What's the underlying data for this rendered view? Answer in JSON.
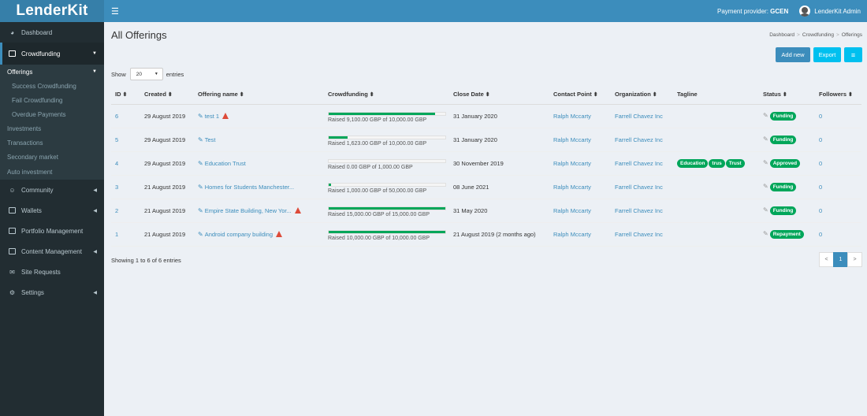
{
  "app": {
    "logo_text": "LenderKit"
  },
  "topbar": {
    "provider_label": "Payment provider:",
    "provider_value": "GCEN",
    "user_name": "LenderKit Admin"
  },
  "sidebar": {
    "dashboard": "Dashboard",
    "crowdfunding": "Crowdfunding",
    "offerings": "Offerings",
    "sub_items": [
      "Success Crowdfunding",
      "Fail Crowdfunding",
      "Overdue Payments"
    ],
    "plain_items": [
      "Investments",
      "Transactions",
      "Secondary market",
      "Auto investment"
    ],
    "sections": [
      "Community",
      "Wallets",
      "Portfolio Management",
      "Content Management",
      "Site Requests",
      "Settings"
    ]
  },
  "page": {
    "title": "All Offerings",
    "breadcrumb": [
      "Dashboard",
      "Crowdfunding",
      "Offerings"
    ],
    "add_button": "Add new",
    "export_button": "Export",
    "show_label": "Show",
    "entries_value": "20",
    "entries_label": "entries",
    "showing_text": "Showing 1 to 6 of 6 entries"
  },
  "table": {
    "headers": [
      "ID",
      "Created",
      "Offering name",
      "Crowdfunding",
      "Close Date",
      "Contact Point",
      "Organization",
      "Tagline",
      "Status",
      "Followers"
    ],
    "rows": [
      {
        "id": "6",
        "created": "29 August 2019",
        "name": "test 1",
        "warn": true,
        "progress": 0.91,
        "raised": "Raised 9,100.00 GBP of 10,000.00 GBP",
        "close": "31 January 2020",
        "contact": "Ralph Mccarty",
        "org": "Farrell Chavez Inc",
        "tags": [],
        "status": "Funding",
        "followers": "0"
      },
      {
        "id": "5",
        "created": "29 August 2019",
        "name": "Test",
        "warn": false,
        "progress": 0.16,
        "raised": "Raised 1,623.00 GBP of 10,000.00 GBP",
        "close": "31 January 2020",
        "contact": "Ralph Mccarty",
        "org": "Farrell Chavez Inc",
        "tags": [],
        "status": "Funding",
        "followers": "0"
      },
      {
        "id": "4",
        "created": "29 August 2019",
        "name": "Education Trust",
        "warn": false,
        "progress": 0,
        "raised": "Raised 0.00 GBP of 1,000.00 GBP",
        "close": "30 November 2019",
        "contact": "Ralph Mccarty",
        "org": "Farrell Chavez Inc",
        "tags": [
          "Education",
          "trus",
          "Trust"
        ],
        "status": "Approved",
        "followers": "0"
      },
      {
        "id": "3",
        "created": "21 August 2019",
        "name": "Homes for Students Manchester...",
        "warn": false,
        "progress": 0.02,
        "raised": "Raised 1,000.00 GBP of 50,000.00 GBP",
        "close": "08 June 2021",
        "contact": "Ralph Mccarty",
        "org": "Farrell Chavez Inc",
        "tags": [],
        "status": "Funding",
        "followers": "0"
      },
      {
        "id": "2",
        "created": "21 August 2019",
        "name": "Empire State Building, New Yor...",
        "warn": true,
        "progress": 1.0,
        "raised": "Raised 15,000.00 GBP of 15,000.00 GBP",
        "close": "31 May 2020",
        "contact": "Ralph Mccarty",
        "org": "Farrell Chavez Inc",
        "tags": [],
        "status": "Funding",
        "followers": "0"
      },
      {
        "id": "1",
        "created": "21 August 2019",
        "name": "Android company building",
        "warn": true,
        "progress": 1.0,
        "raised": "Raised 10,000.00 GBP of 10,000.00 GBP",
        "close": "21 August 2019 (2 months ago)",
        "contact": "Ralph Mccarty",
        "org": "Farrell Chavez Inc",
        "tags": [],
        "status": "Repayment",
        "followers": "0"
      }
    ]
  },
  "pagination": {
    "prev": "<",
    "current": "1",
    "next": ">"
  },
  "colors": {
    "brand": "#3c8dbc",
    "sidebar": "#222d32",
    "success": "#00a65a",
    "info": "#00c0ef",
    "danger": "#dd4b39"
  }
}
